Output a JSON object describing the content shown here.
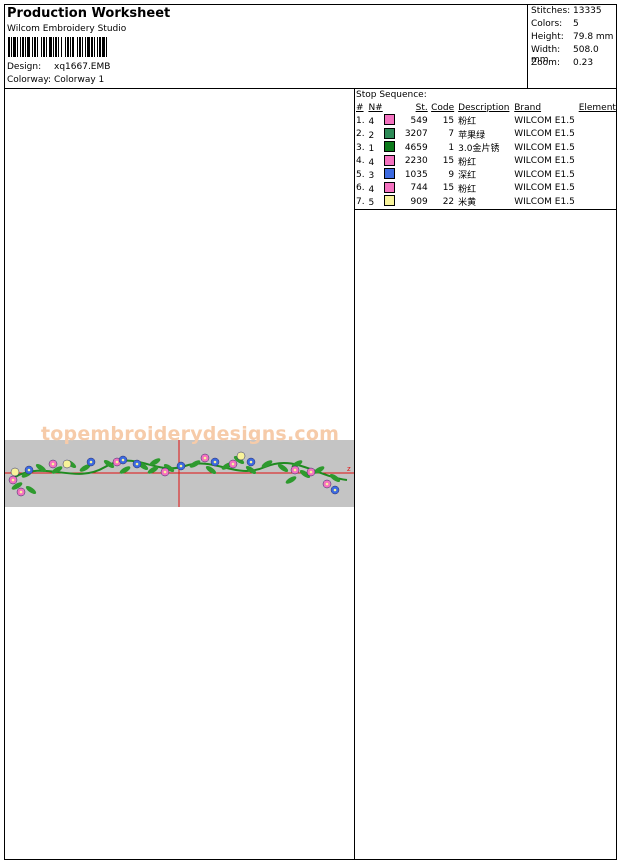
{
  "header": {
    "title": "Production Worksheet",
    "subtitle": "Wilcom  Embroidery Studio",
    "design_label": "Design:",
    "design_value": "xq1667.EMB",
    "colorway_label": "Colorway:",
    "colorway_value": "Colorway 1"
  },
  "stats": [
    {
      "label": "Stitches:",
      "value": "13335"
    },
    {
      "label": "Colors:",
      "value": "5"
    },
    {
      "label": "Height:",
      "value": "79.8 mm"
    },
    {
      "label": "Width:",
      "value": "508.0 mm"
    },
    {
      "label": "Zoom:",
      "value": "0.23"
    }
  ],
  "stop_sequence": {
    "title": "Stop Sequence:",
    "columns": [
      "#",
      "N#",
      "St.",
      "Code",
      "Description",
      "Brand",
      "Element"
    ],
    "rows": [
      {
        "num": "1.",
        "n": "4",
        "color": "#f472c0",
        "st": "549",
        "code": "15",
        "desc": "粉红",
        "brand": "WILCOM E1.5"
      },
      {
        "num": "2.",
        "n": "2",
        "color": "#2e8b57",
        "st": "3207",
        "code": "7",
        "desc": "苹果绿",
        "brand": "WILCOM E1.5"
      },
      {
        "num": "3.",
        "n": "1",
        "color": "#0b7a1a",
        "st": "4659",
        "code": "1",
        "desc": "3.0金片锈",
        "brand": "WILCOM E1.5"
      },
      {
        "num": "4.",
        "n": "4",
        "color": "#f472c0",
        "st": "2230",
        "code": "15",
        "desc": "粉红",
        "brand": "WILCOM E1.5"
      },
      {
        "num": "5.",
        "n": "3",
        "color": "#3c6ae0",
        "st": "1035",
        "code": "9",
        "desc": "深红",
        "brand": "WILCOM E1.5"
      },
      {
        "num": "6.",
        "n": "4",
        "color": "#f472c0",
        "st": "744",
        "code": "15",
        "desc": "粉红",
        "brand": "WILCOM E1.5"
      },
      {
        "num": "7.",
        "n": "5",
        "color": "#f8f39a",
        "st": "909",
        "code": "22",
        "desc": "米黄",
        "brand": "WILCOM E1.5"
      }
    ]
  },
  "preview": {
    "watermark": "topembroiderydesigns.com",
    "band_color": "#c4c4c4",
    "crosshair_color": "#e01010",
    "axis_label": "z"
  }
}
